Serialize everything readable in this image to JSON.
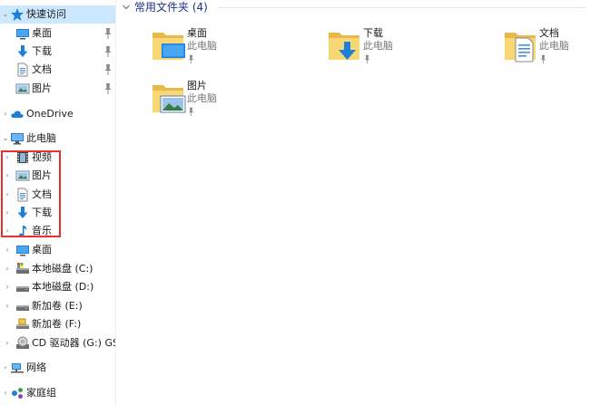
{
  "nav": {
    "quick_access": {
      "label": "快速访问",
      "items": [
        {
          "label": "桌面",
          "icon": "desktop-icon"
        },
        {
          "label": "下载",
          "icon": "download-icon"
        },
        {
          "label": "文档",
          "icon": "document-icon"
        },
        {
          "label": "图片",
          "icon": "pictures-icon"
        }
      ]
    },
    "onedrive": {
      "label": "OneDrive"
    },
    "this_pc": {
      "label": "此电脑",
      "folders": [
        {
          "label": "视频",
          "icon": "video-icon"
        },
        {
          "label": "图片",
          "icon": "pictures-icon"
        },
        {
          "label": "文档",
          "icon": "document-icon"
        },
        {
          "label": "下载",
          "icon": "download-icon"
        },
        {
          "label": "音乐",
          "icon": "music-icon"
        },
        {
          "label": "桌面",
          "icon": "desktop-icon"
        }
      ],
      "drives": [
        {
          "label": "本地磁盘 (C:)",
          "icon": "local-disk-c-icon"
        },
        {
          "label": "本地磁盘 (D:)",
          "icon": "local-disk-icon"
        },
        {
          "label": "新加卷 (E:)",
          "icon": "local-disk-icon"
        },
        {
          "label": "新加卷 (F:)",
          "icon": "usb-drive-icon"
        },
        {
          "label": "CD 驱动器 (G:) GSP",
          "icon": "cd-drive-icon"
        }
      ]
    },
    "network": {
      "label": "网络"
    },
    "homegroup": {
      "label": "家庭组"
    }
  },
  "content": {
    "group_title": "常用文件夹 (4)",
    "tiles": [
      {
        "name": "桌面",
        "location": "此电脑",
        "icon": "desktop-folder-icon"
      },
      {
        "name": "下载",
        "location": "此电脑",
        "icon": "download-folder-icon"
      },
      {
        "name": "文档",
        "location": "此电脑",
        "icon": "document-folder-icon"
      },
      {
        "name": "图片",
        "location": "此电脑",
        "icon": "pictures-folder-icon"
      }
    ]
  },
  "colors": {
    "selection": "#cce8ff",
    "highlight_box": "#e8312f",
    "group_title": "#1e3287",
    "folder_yellow": "#f8d775",
    "accent_blue": "#1e7fd8"
  }
}
